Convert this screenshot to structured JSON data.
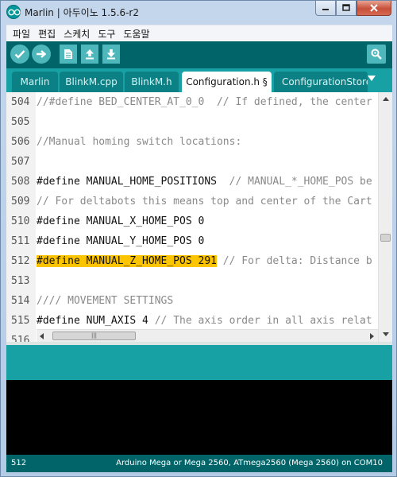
{
  "window": {
    "title": "Marlin | 아두이노 1.5.6-r2",
    "icon": "arduino-logo-icon"
  },
  "menu": [
    "파일",
    "편집",
    "스케치",
    "도구",
    "도움말"
  ],
  "toolbar": {
    "buttons": [
      "verify-icon",
      "upload-icon",
      "new-icon",
      "open-icon",
      "save-icon"
    ],
    "serial_monitor": "serial-monitor-icon"
  },
  "tabs": [
    "Marlin",
    "BlinkM.cpp",
    "BlinkM.h",
    "Configuration.h §",
    "ConfigurationStore"
  ],
  "active_tab": "Configuration.h §",
  "editor": {
    "lines": [
      {
        "num": "504",
        "code": "",
        "comment": "//#define BED_CENTER_AT_0_0  // If defined, the center"
      },
      {
        "num": "505",
        "code": "",
        "comment": ""
      },
      {
        "num": "506",
        "code": "",
        "comment": "//Manual homing switch locations:"
      },
      {
        "num": "507",
        "code": "",
        "comment": ""
      },
      {
        "num": "508",
        "code": "#define MANUAL_HOME_POSITIONS  ",
        "comment": "// MANUAL_*_HOME_POS be"
      },
      {
        "num": "509",
        "code": "",
        "comment": "// For deltabots this means top and center of the Cart"
      },
      {
        "num": "510",
        "code": "#define MANUAL_X_HOME_POS 0",
        "comment": ""
      },
      {
        "num": "511",
        "code": "#define MANUAL_Y_HOME_POS 0",
        "comment": ""
      },
      {
        "num": "512",
        "code": "#define MANUAL_Z_HOME_POS 291",
        "comment": " // For delta: Distance b",
        "highlight": true
      },
      {
        "num": "513",
        "code": "",
        "comment": ""
      },
      {
        "num": "514",
        "code": "",
        "comment": "//// MOVEMENT SETTINGS"
      },
      {
        "num": "515",
        "code": "#define NUM_AXIS 4 ",
        "comment": "// The axis order in all axis relat"
      },
      {
        "num": "516",
        "code": "",
        "comment": ""
      }
    ],
    "highlight_color": "#fdc400"
  },
  "footer": {
    "line": "512",
    "board": "Arduino Mega or Mega 2560, ATmega2560 (Mega 2560) on COM10"
  },
  "colors": {
    "toolbar": "#006468",
    "tabbar": "#17a1a5",
    "console": "#000000"
  }
}
